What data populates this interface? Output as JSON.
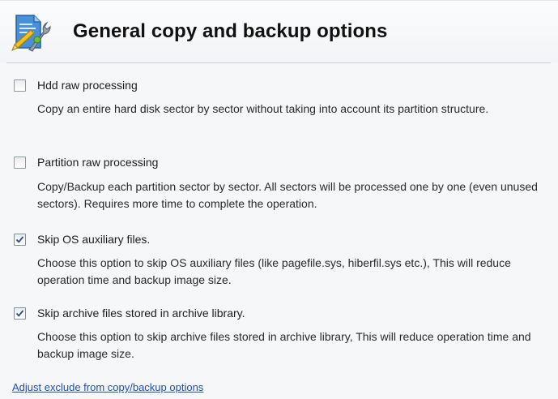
{
  "header": {
    "title": "General copy and backup options",
    "icon": "document-wrench-icon"
  },
  "options": [
    {
      "label": "Hdd raw processing",
      "description": "Copy an entire hard disk sector by sector without taking into account its partition structure.",
      "checked": false
    },
    {
      "label": "Partition raw processing",
      "description": "Copy/Backup each partition sector by sector. All sectors will be processed one by one (even unused sectors). Requires more time to complete the operation.",
      "checked": false
    },
    {
      "label": "Skip OS auxiliary files.",
      "description": "Choose this option to skip OS auxiliary files (like pagefile.sys, hiberfil.sys etc.), This will reduce operation time and backup image size.",
      "checked": true
    },
    {
      "label": "Skip archive files stored in archive library.",
      "description": "Choose this option to skip archive files stored in archive library, This will reduce operation time and backup image size.",
      "checked": true
    }
  ],
  "link": {
    "text": "Adjust exclude from copy/backup options"
  },
  "colors": {
    "link": "#1f4fb8",
    "checkmark": "#2d4a86"
  }
}
